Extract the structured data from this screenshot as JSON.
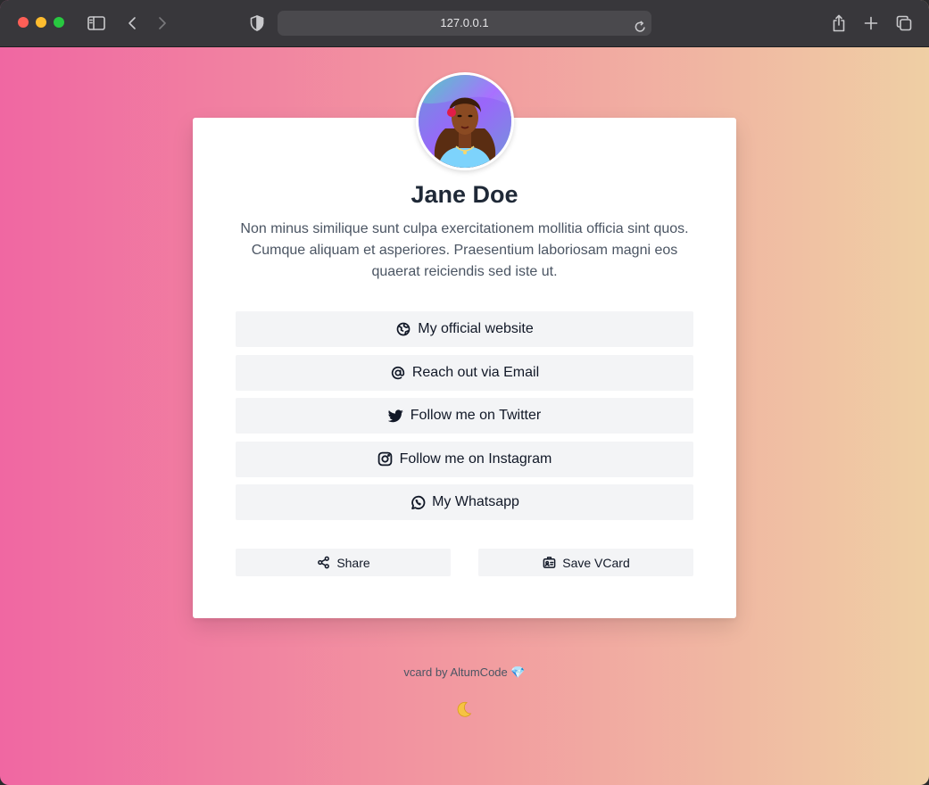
{
  "browser": {
    "url": "127.0.0.1"
  },
  "profile": {
    "name": "Jane Doe",
    "bio": "Non minus similique sunt culpa exercitationem mollitia officia sint quos. Cumque aliquam et asperiores. Praesentium laboriosam magni eos quaerat reiciendis sed iste ut."
  },
  "links": [
    {
      "label": "My official website",
      "icon": "globe-icon"
    },
    {
      "label": "Reach out via Email",
      "icon": "at-sign-icon"
    },
    {
      "label": "Follow me on Twitter",
      "icon": "twitter-icon"
    },
    {
      "label": "Follow me on Instagram",
      "icon": "instagram-icon"
    },
    {
      "label": "My Whatsapp",
      "icon": "whatsapp-icon"
    }
  ],
  "actions": {
    "share_label": "Share",
    "save_vcard_label": "Save VCard"
  },
  "footer": {
    "credit": "vcard by AltumCode",
    "gem": "💎"
  },
  "colors": {
    "gradient_start": "#f067a2",
    "gradient_end": "#efcfa4",
    "button_bg": "#f3f4f6"
  }
}
